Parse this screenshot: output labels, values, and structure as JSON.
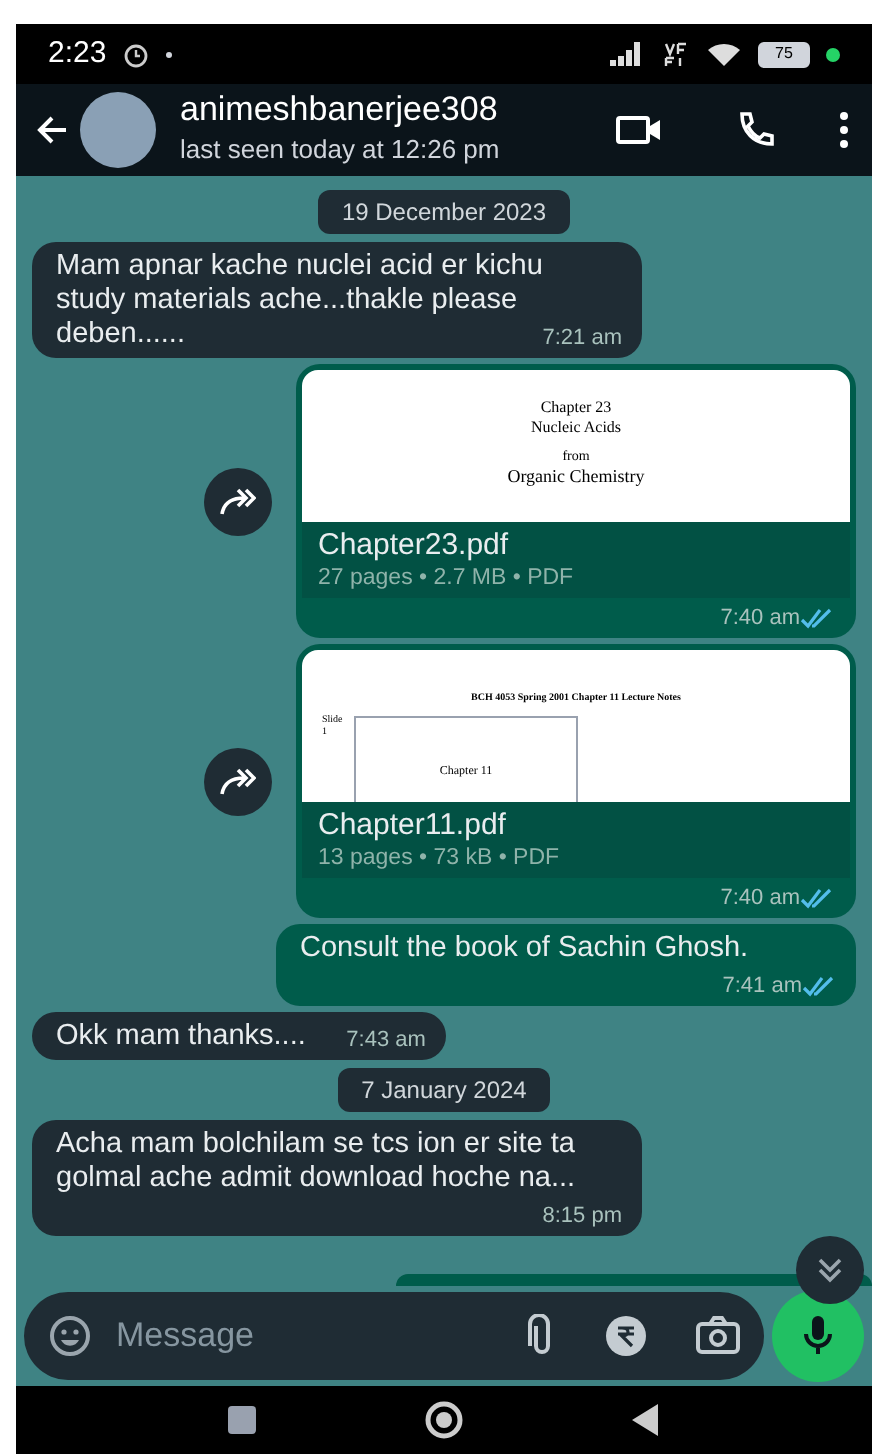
{
  "status_bar": {
    "time": "2:23",
    "battery": "75"
  },
  "header": {
    "contact_name": "animeshbanerjee308",
    "last_seen": "last seen today at 12:26 pm"
  },
  "messages": [
    {
      "kind": "date",
      "text": "19 December 2023"
    },
    {
      "kind": "incoming",
      "text": "Mam apnar kache nuclei acid er kichu study materials ache...thakle please deben......",
      "time": "7:21 am"
    },
    {
      "kind": "outgoing_file",
      "preview_lines": [
        {
          "kind": "heading",
          "text": "Chapter 23"
        },
        {
          "kind": "heading",
          "text": "Nucleic Acids"
        },
        {
          "kind": "small",
          "text": "from"
        },
        {
          "kind": "title",
          "text": "Organic Chemistry"
        }
      ],
      "file_name": "Chapter23.pdf",
      "file_info": "27 pages • 2.7 MB • PDF",
      "time": "7:40 am",
      "read": true
    },
    {
      "kind": "outgoing_file",
      "preview_lines": [
        {
          "kind": "banner",
          "text": "BCH 4053 Spring 2001 Chapter 11 Lecture Notes"
        },
        {
          "kind": "slide_number",
          "text": "Slide 1"
        },
        {
          "kind": "slide_title",
          "text": "Chapter 11"
        }
      ],
      "file_name": "Chapter11.pdf",
      "file_info": "13 pages • 73 kB • PDF",
      "time": "7:40 am",
      "read": true
    },
    {
      "kind": "outgoing",
      "text": "Consult the book of Sachin Ghosh.",
      "time": "7:41 am",
      "read": true
    },
    {
      "kind": "incoming",
      "text": "Okk mam thanks....",
      "time": "7:43 am"
    },
    {
      "kind": "date",
      "text": "7 January 2024"
    },
    {
      "kind": "incoming",
      "text": "Acha mam bolchilam se tcs ion er site ta golmal ache admit download hoche na...",
      "time": "8:15 pm"
    }
  ],
  "composer": {
    "placeholder": "Message"
  }
}
